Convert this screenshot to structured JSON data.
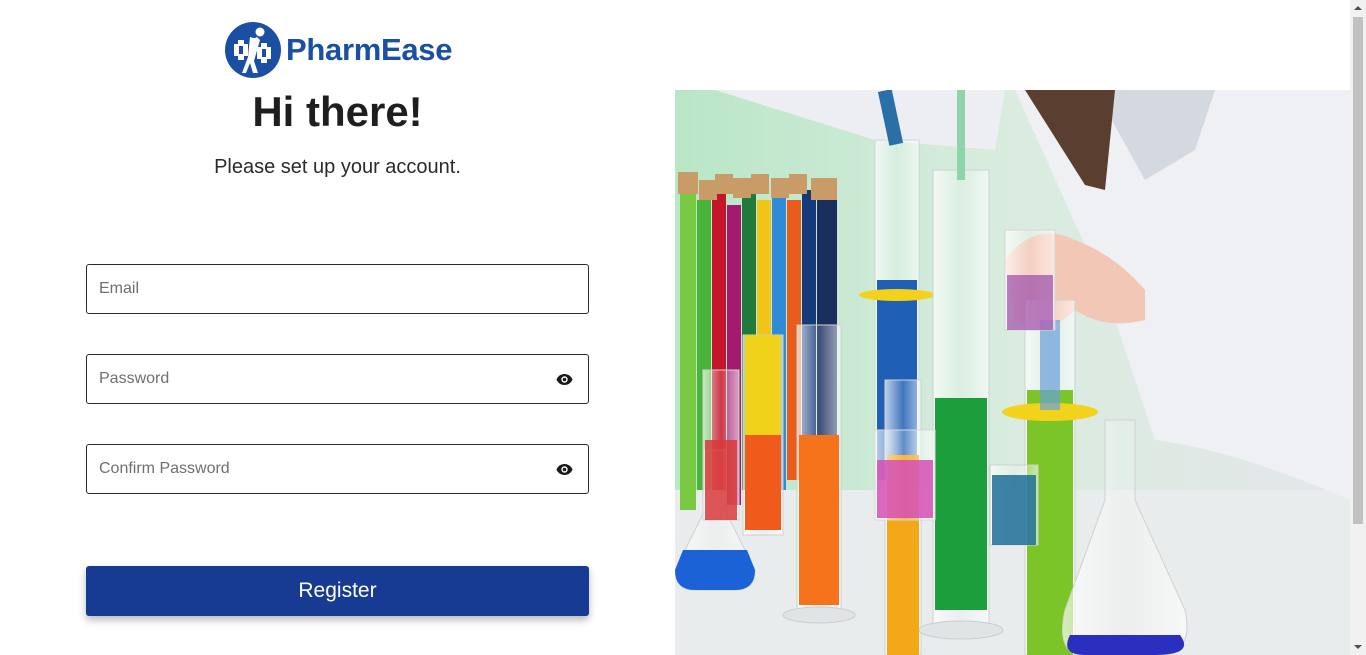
{
  "brand": {
    "name": "PharmEase",
    "color": "#1a4fa3"
  },
  "header": {
    "title": "Hi there!",
    "subtitle": "Please set up your account."
  },
  "form": {
    "email": {
      "placeholder": "Email",
      "value": ""
    },
    "password": {
      "placeholder": "Password",
      "value": "",
      "toggle_icon": "eye-icon"
    },
    "confirm_password": {
      "placeholder": "Confirm Password",
      "value": "",
      "toggle_icon": "eye-icon"
    },
    "submit_label": "Register",
    "submit_color": "#173a93"
  },
  "hero_image": {
    "subject": "lab-glassware-with-colored-liquids"
  }
}
